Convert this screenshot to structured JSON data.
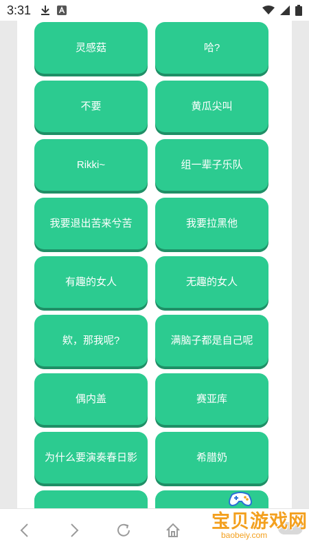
{
  "status_bar": {
    "time": "3:31",
    "icons": [
      "download-icon",
      "a-icon",
      "wifi-icon",
      "signal-icon",
      "battery-icon"
    ]
  },
  "tiles": [
    "灵感菇",
    "哈?",
    "不要",
    "黄瓜尖叫",
    "Rikki~",
    "组一辈子乐队",
    "我要退出苦来兮苦",
    "我要拉黑他",
    "有趣的女人",
    "无趣的女人",
    "欸，那我呢?",
    "满脑子都是自己呢",
    "偶内盖",
    "赛亚库",
    "为什么要演奏春日影",
    "希腊奶",
    "",
    ""
  ],
  "nav": {
    "icons": [
      "back-icon",
      "forward-icon",
      "refresh-icon",
      "home-icon"
    ]
  },
  "watermark": {
    "title": "宝贝游戏网",
    "url": "baobeiy.com"
  },
  "colors": {
    "tile": "#2ccb90",
    "tile_shadow": "#1f8f66",
    "watermark": "#f3a01f"
  }
}
